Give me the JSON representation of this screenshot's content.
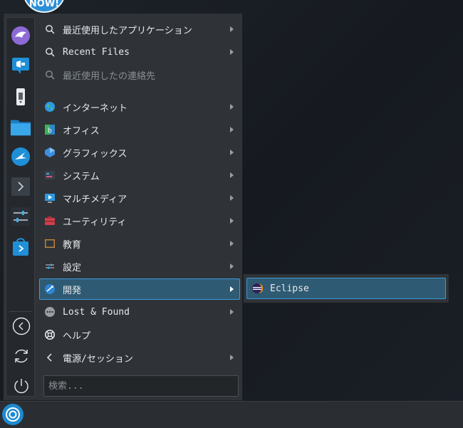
{
  "desktop": {
    "badge_text": "NOW!"
  },
  "favorites": [
    {
      "name": "Eagle",
      "icon": "eagle-icon"
    },
    {
      "name": "Announcer",
      "icon": "megaphone-icon"
    },
    {
      "name": "USB",
      "icon": "usb-drive-icon"
    },
    {
      "name": "Files",
      "icon": "folder-icon"
    },
    {
      "name": "Kdeconnect",
      "icon": "bird-icon"
    },
    {
      "name": "Terminal",
      "icon": "terminal-icon"
    },
    {
      "name": "Settings",
      "icon": "sliders-icon"
    },
    {
      "name": "Discover",
      "icon": "store-bag-icon"
    }
  ],
  "system_buttons": [
    {
      "icon": "back-circle-icon"
    },
    {
      "icon": "refresh-circle-icon"
    },
    {
      "icon": "power-icon"
    }
  ],
  "menu": {
    "items": [
      {
        "label": "最近使用したアプリケーション",
        "icon": "search-icon",
        "arrow": true
      },
      {
        "label": "Recent Files",
        "icon": "search-icon",
        "arrow": true
      },
      {
        "label": "最近使用したの連絡先",
        "icon": "search-icon",
        "arrow": false,
        "disabled": true
      },
      {
        "label": "インターネット",
        "icon": "globe-icon",
        "arrow": true
      },
      {
        "label": "オフィス",
        "icon": "office-icon",
        "arrow": true
      },
      {
        "label": "グラフィックス",
        "icon": "graphics-icon",
        "arrow": true
      },
      {
        "label": "システム",
        "icon": "system-icon",
        "arrow": true
      },
      {
        "label": "マルチメディア",
        "icon": "multimedia-icon",
        "arrow": true
      },
      {
        "label": "ユーティリティ",
        "icon": "utilities-icon",
        "arrow": true
      },
      {
        "label": "教育",
        "icon": "education-icon",
        "arrow": true
      },
      {
        "label": "設定",
        "icon": "settings-icon",
        "arrow": true
      },
      {
        "label": "開発",
        "icon": "development-icon",
        "arrow": true,
        "active": true
      },
      {
        "label": "Lost & Found",
        "icon": "lost-found-icon",
        "arrow": true
      },
      {
        "label": "ヘルプ",
        "icon": "help-icon",
        "arrow": false
      },
      {
        "label": "電源/セッション",
        "icon": "chevron-left-icon",
        "arrow": true
      }
    ],
    "search_placeholder": "検索..."
  },
  "submenu": {
    "items": [
      {
        "label": "Eclipse",
        "icon": "eclipse-icon"
      }
    ]
  },
  "colors": {
    "accent": "#3d9ad9",
    "active_bg": "#2f5a73",
    "panel_bg": "#2f3338"
  }
}
